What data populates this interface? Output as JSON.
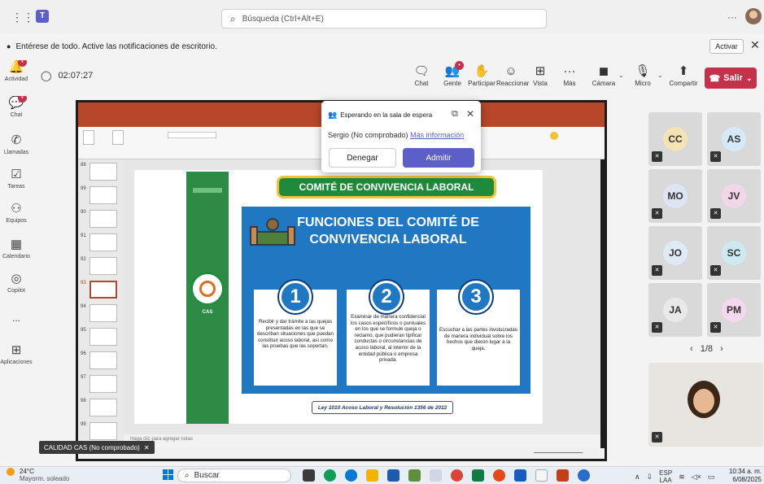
{
  "search": {
    "placeholder": "Búsqueda (Ctrl+Alt+E)"
  },
  "notification": {
    "text": "Entérese de todo. Active las notificaciones de escritorio.",
    "button": "Activar"
  },
  "rail": [
    {
      "label": "Actividad",
      "icon": "bell-icon",
      "badge": ""
    },
    {
      "label": "Chat",
      "icon": "chat-icon",
      "badge": ""
    },
    {
      "label": "Llamadas",
      "icon": "phone-icon",
      "badge": ""
    },
    {
      "label": "Tareas",
      "icon": "tasks-icon",
      "badge": ""
    },
    {
      "label": "Equipos",
      "icon": "teams-icon",
      "badge": ""
    },
    {
      "label": "Calendario",
      "icon": "calendar-icon",
      "badge": ""
    },
    {
      "label": "Copilot",
      "icon": "copilot-icon",
      "badge": ""
    },
    {
      "label": "...",
      "icon": "more-icon",
      "badge": ""
    },
    {
      "label": "Aplicaciones",
      "icon": "apps-icon",
      "badge": ""
    }
  ],
  "meeting": {
    "timer": "02:07:27",
    "toolbar": [
      "Chat",
      "Gente",
      "Participar",
      "Reaccionar",
      "Vista",
      "Más",
      "Cámara",
      "Micro",
      "Compartir"
    ],
    "leave": "Salir"
  },
  "popup": {
    "title": "Esperando en la sala de espera",
    "person": "Sergio (No comprobado)",
    "link": "Más información",
    "deny": "Denegar",
    "admit": "Admitir"
  },
  "slide": {
    "header": "COMITÉ DE CONVIVENCIA LABORAL",
    "title_line1": "FUNCIONES DEL COMITÉ DE",
    "title_line2": "CONVIVENCIA LABORAL",
    "items": [
      {
        "num": "1",
        "text": "Recibir y dar trámite a las quejas presentadas en las que se describan situaciones que puedan constituir acoso laboral, así como las pruebas que las soportan."
      },
      {
        "num": "2",
        "text": "Examinar de manera confidencial los casos específicos o puntuales en los que se formule queja o reclamo, que pudieran tipificar conductas o circunstancias de acoso laboral, al interior de la entidad pública o empresa privada."
      },
      {
        "num": "3",
        "text": "Escuchar a las partes involucradas de manera individual sobre los hechos que dieron lugar a la queja."
      }
    ],
    "footer": "Ley 1010 Acoso Laboral y Resolución 1356 de 2012",
    "band_logo": "CAS"
  },
  "ppt": {
    "thumb_numbers": [
      "88",
      "89",
      "90",
      "91",
      "92",
      "93",
      "94",
      "95",
      "96",
      "97",
      "98",
      "99"
    ],
    "notes": "Haga clic para agregar notas"
  },
  "participants": [
    {
      "initials": "CC",
      "color": "#f4e3b5"
    },
    {
      "initials": "AS",
      "color": "#d6e9f8"
    },
    {
      "initials": "MO",
      "color": "#dde5f4"
    },
    {
      "initials": "JV",
      "color": "#f3d6e8"
    },
    {
      "initials": "JO",
      "color": "#e0eaf6"
    },
    {
      "initials": "SC",
      "color": "#cfe9f3"
    },
    {
      "initials": "JA",
      "color": "#e9e9e9"
    },
    {
      "initials": "PM",
      "color": "#f6d8ee"
    }
  ],
  "pager": "1/8",
  "share_tag": "CALIDAD CAS (No comprobado)",
  "taskbar": {
    "weather_temp": "24°C",
    "weather_desc": "Mayorm. soleado",
    "search": "Buscar",
    "lang1": "ESP",
    "lang2": "LAA",
    "time": "10:34 a. m.",
    "date": "6/08/2025"
  }
}
